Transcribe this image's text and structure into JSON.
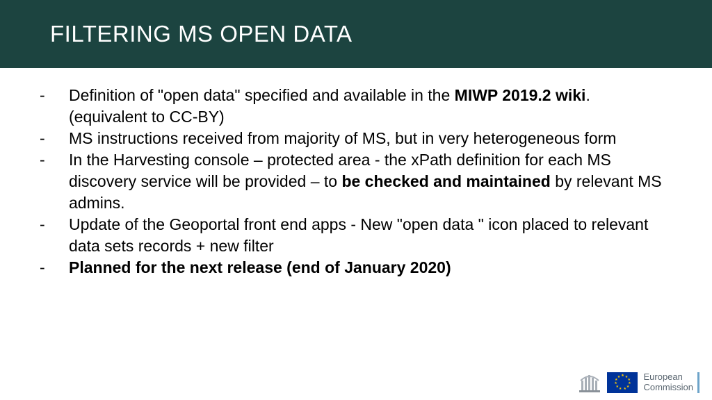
{
  "header": {
    "title": "FILTERING MS OPEN DATA"
  },
  "bullets": {
    "dash": "-",
    "item1_pre": "Definition of \"open data\" specified and available in the ",
    "item1_bold": "MIWP 2019.2 wiki",
    "item1_post": ". (equivalent to CC-BY)",
    "item2": "MS instructions received from majority of MS, but in very heterogeneous form",
    "item3_pre": "In the Harvesting console – protected area - the xPath definition for each MS discovery service will be provided – to ",
    "item3_bold": "be checked and maintained",
    "item3_post": " by relevant MS admins.",
    "item4": "Update of the Geoportal front end apps - New \"open data \" icon placed to relevant data sets records + new filter",
    "item5": "Planned for the next release (end of January 2020)"
  },
  "logo": {
    "line1": "European",
    "line2": "Commission"
  }
}
